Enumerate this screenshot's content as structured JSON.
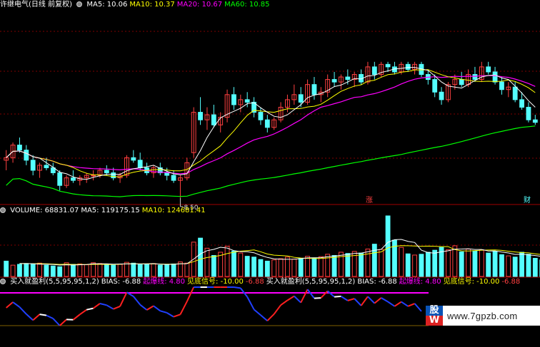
{
  "header": {
    "title": "许继电气(日线 前复权)",
    "ma": [
      {
        "label": "MA5: 10.06",
        "color": "#ffffff"
      },
      {
        "label": "MA10: 10.37",
        "color": "#ffff00"
      },
      {
        "label": "MA20: 10.67",
        "color": "#ff00ff"
      },
      {
        "label": "MA60: 10.85",
        "color": "#00ff00"
      }
    ]
  },
  "volume_header": {
    "items": [
      {
        "label": "VOLUME: 68831.07",
        "color": "#ffffff"
      },
      {
        "label": "MA5: 119175.15",
        "color": "#ffffff"
      },
      {
        "label": "MA10: 124681.41",
        "color": "#ffff00"
      }
    ]
  },
  "indicator_header": {
    "items": [
      {
        "label": "买入就盈利(5,5,95,95,1,2)",
        "color": "#ffffff"
      },
      {
        "label": "BIAS: -6.88",
        "color": "#ffffff"
      },
      {
        "label": "起爆线: 4.80",
        "color": "#ff00ff"
      },
      {
        "label": "见底信号: -10.00",
        "color": "#ffff00"
      },
      {
        "label": "-6.88",
        "color": "#ff4040"
      },
      {
        "label": "买入就盈利(5,5,95,95,1,2)",
        "color": "#ffffff"
      },
      {
        "label": "BIAS: -6.88",
        "color": "#ffffff"
      },
      {
        "label": "起爆线: 4.80",
        "color": "#ff00ff"
      },
      {
        "label": "见底信号: -10.00",
        "color": "#ffff00"
      },
      {
        "label": "-6.88",
        "color": "#ff4040"
      }
    ]
  },
  "price_annotations": {
    "low_label": "8.50",
    "badge_1": "涨",
    "badge_2": "财"
  },
  "watermark": {
    "logo_top": "股",
    "logo_bottom": "W",
    "url": "www.7gpzb.com"
  },
  "colors": {
    "up": "#ff4040",
    "down": "#54ffff",
    "ma5": "#ffffff",
    "ma10": "#ffff00",
    "ma20": "#ff00ff",
    "ma60": "#00ff00",
    "grid": "#800000",
    "bias_up": "#ff2020",
    "bias_down": "#2040ff",
    "bias_flat": "#ffffff",
    "line_4_8": "#ff00ff"
  },
  "chart_data": [
    {
      "type": "candlestick",
      "ylim": [
        8.4,
        12.2
      ],
      "ohlc": [
        [
          9.25,
          9.45,
          9.05,
          9.3
        ],
        [
          9.3,
          9.6,
          9.2,
          9.55
        ],
        [
          9.55,
          9.7,
          9.4,
          9.45
        ],
        [
          9.45,
          9.55,
          9.15,
          9.25
        ],
        [
          9.25,
          9.35,
          8.95,
          9.05
        ],
        [
          9.05,
          9.2,
          8.9,
          9.15
        ],
        [
          9.15,
          9.3,
          9.05,
          9.1
        ],
        [
          9.1,
          9.2,
          8.95,
          9.0
        ],
        [
          9.0,
          9.05,
          8.65,
          8.75
        ],
        [
          8.75,
          8.95,
          8.7,
          8.9
        ],
        [
          8.9,
          9.05,
          8.8,
          8.85
        ],
        [
          8.85,
          8.95,
          8.75,
          8.9
        ],
        [
          8.9,
          9.0,
          8.8,
          8.95
        ],
        [
          8.95,
          9.05,
          8.85,
          8.95
        ],
        [
          8.95,
          9.1,
          8.9,
          9.05
        ],
        [
          9.05,
          9.15,
          8.95,
          9.0
        ],
        [
          9.0,
          9.1,
          8.85,
          8.9
        ],
        [
          8.9,
          9.0,
          8.8,
          8.95
        ],
        [
          8.95,
          9.35,
          8.9,
          9.3
        ],
        [
          9.3,
          9.45,
          9.2,
          9.25
        ],
        [
          9.25,
          9.4,
          9.05,
          9.1
        ],
        [
          9.1,
          9.2,
          8.95,
          9.0
        ],
        [
          9.0,
          9.15,
          8.9,
          9.1
        ],
        [
          9.1,
          9.2,
          8.95,
          9.0
        ],
        [
          9.0,
          9.1,
          8.85,
          8.95
        ],
        [
          8.95,
          9.05,
          8.8,
          8.85
        ],
        [
          8.85,
          8.95,
          8.5,
          8.9
        ],
        [
          8.9,
          9.3,
          8.85,
          9.2
        ],
        [
          9.4,
          10.3,
          9.3,
          10.2
        ],
        [
          10.2,
          10.5,
          9.95,
          10.05
        ],
        [
          10.05,
          10.3,
          9.85,
          10.15
        ],
        [
          10.15,
          10.35,
          9.9,
          9.95
        ],
        [
          9.95,
          10.2,
          9.8,
          10.1
        ],
        [
          10.1,
          10.65,
          10.0,
          10.55
        ],
        [
          10.55,
          10.7,
          10.25,
          10.35
        ],
        [
          10.35,
          10.55,
          10.2,
          10.45
        ],
        [
          10.45,
          10.6,
          10.3,
          10.4
        ],
        [
          10.4,
          10.5,
          10.1,
          10.2
        ],
        [
          10.2,
          10.3,
          9.95,
          10.05
        ],
        [
          10.05,
          10.15,
          9.8,
          9.9
        ],
        [
          9.9,
          10.1,
          9.85,
          10.05
        ],
        [
          10.05,
          10.4,
          10.0,
          10.3
        ],
        [
          10.3,
          10.55,
          10.2,
          10.45
        ],
        [
          10.45,
          10.75,
          10.35,
          10.55
        ],
        [
          10.55,
          10.7,
          10.3,
          10.4
        ],
        [
          10.4,
          10.85,
          10.35,
          10.75
        ],
        [
          10.75,
          10.9,
          10.45,
          10.55
        ],
        [
          10.55,
          10.7,
          10.4,
          10.6
        ],
        [
          10.6,
          10.95,
          10.5,
          10.85
        ],
        [
          10.85,
          11.0,
          10.7,
          10.8
        ],
        [
          10.8,
          10.95,
          10.65,
          10.9
        ],
        [
          10.9,
          11.05,
          10.75,
          10.85
        ],
        [
          10.85,
          11.0,
          10.7,
          10.95
        ],
        [
          10.95,
          11.05,
          10.75,
          10.8
        ],
        [
          10.8,
          11.2,
          10.75,
          11.1
        ],
        [
          11.1,
          11.2,
          10.85,
          10.95
        ],
        [
          10.95,
          11.2,
          10.9,
          11.15
        ],
        [
          11.15,
          11.2,
          11.0,
          11.1
        ],
        [
          11.1,
          11.2,
          10.95,
          11.0
        ],
        [
          11.0,
          11.2,
          10.95,
          11.15
        ],
        [
          11.15,
          11.2,
          11.0,
          11.05
        ],
        [
          11.05,
          11.2,
          10.95,
          11.15
        ],
        [
          11.15,
          11.2,
          10.9,
          10.95
        ],
        [
          10.95,
          11.05,
          10.75,
          10.85
        ],
        [
          10.85,
          10.95,
          10.5,
          10.6
        ],
        [
          10.6,
          10.7,
          10.35,
          10.45
        ],
        [
          10.45,
          10.8,
          10.4,
          10.75
        ],
        [
          10.75,
          10.95,
          10.65,
          10.85
        ],
        [
          10.85,
          11.0,
          10.7,
          10.75
        ],
        [
          10.75,
          11.05,
          10.7,
          10.95
        ],
        [
          10.95,
          11.1,
          10.8,
          10.85
        ],
        [
          10.85,
          11.2,
          10.8,
          11.1
        ],
        [
          11.1,
          11.2,
          10.95,
          11.0
        ],
        [
          11.0,
          11.1,
          10.75,
          10.8
        ],
        [
          10.8,
          10.9,
          10.55,
          10.65
        ],
        [
          10.65,
          10.8,
          10.5,
          10.7
        ],
        [
          10.7,
          10.8,
          10.4,
          10.45
        ],
        [
          10.45,
          10.6,
          10.25,
          10.3
        ],
        [
          10.3,
          10.4,
          10.0,
          10.05
        ],
        [
          10.05,
          10.15,
          9.95,
          10.0
        ]
      ]
    },
    {
      "type": "bar",
      "series_name": "VOLUME",
      "values": [
        38,
        28,
        30,
        32,
        30,
        33,
        28,
        26,
        24,
        34,
        30,
        31,
        29,
        34,
        32,
        30,
        28,
        30,
        35,
        33,
        29,
        30,
        32,
        28,
        30,
        31,
        36,
        33,
        85,
        95,
        70,
        52,
        60,
        75,
        63,
        58,
        50,
        48,
        42,
        38,
        41,
        44,
        48,
        43,
        45,
        50,
        46,
        49,
        55,
        52,
        60,
        57,
        62,
        58,
        68,
        80,
        67,
        150,
        90,
        72,
        56,
        53,
        55,
        60,
        65,
        72,
        66,
        76,
        61,
        68,
        63,
        66,
        58,
        62,
        54,
        51,
        48,
        60,
        55,
        45,
        41,
        40,
        43,
        35
      ],
      "up_flags": [
        0,
        1,
        0,
        0,
        0,
        1,
        0,
        0,
        0,
        1,
        0,
        1,
        1,
        1,
        1,
        0,
        0,
        1,
        1,
        0,
        0,
        0,
        1,
        0,
        0,
        0,
        1,
        1,
        1,
        0,
        1,
        0,
        1,
        1,
        0,
        1,
        0,
        0,
        0,
        0,
        1,
        1,
        1,
        1,
        0,
        1,
        0,
        1,
        1,
        0,
        1,
        0,
        1,
        0,
        1,
        0,
        1,
        0,
        0,
        1,
        0,
        1,
        0,
        0,
        0,
        0,
        1,
        1,
        0,
        1,
        0,
        1,
        0,
        0,
        0,
        1,
        0,
        0,
        0,
        0,
        0,
        0,
        0
      ]
    },
    {
      "type": "line",
      "series_name": "BIAS",
      "value": -6.88,
      "reference_lines": {
        "起爆线": 4.8,
        "见底信号": -10.0
      }
    }
  ]
}
